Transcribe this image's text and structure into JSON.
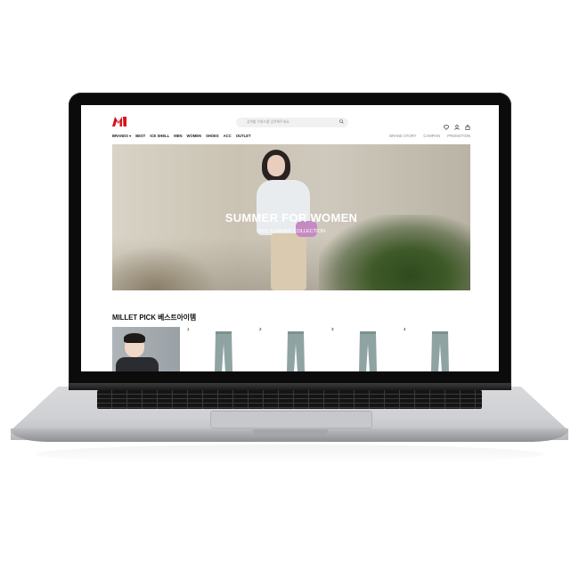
{
  "header": {
    "logo_text": "M",
    "search_placeholder": "검색할 키워드를 입력해주세요.",
    "icons": [
      "heart-icon",
      "user-icon",
      "cart-icon"
    ]
  },
  "gnb": {
    "items": [
      "BRANDS ▾",
      "BEST",
      "ICE SHELL",
      "MEN",
      "WOMEN",
      "SHOES",
      "ACC",
      "OUTLET"
    ]
  },
  "sub_nav": {
    "items": [
      "BRAND STORY",
      "CAMPAIN",
      "PROMOTION"
    ]
  },
  "hero": {
    "title": "SUMMER FOR WOMEN",
    "subtitle": "2023 SUMMER COLLECTION"
  },
  "section": {
    "title": "MILLET PICK 베스트아이템"
  },
  "products": [
    {
      "rank": "1"
    },
    {
      "rank": "2"
    },
    {
      "rank": "3"
    },
    {
      "rank": "4"
    }
  ],
  "colors": {
    "brand_red": "#d7141b",
    "pants_color": "#8fa3a3"
  }
}
